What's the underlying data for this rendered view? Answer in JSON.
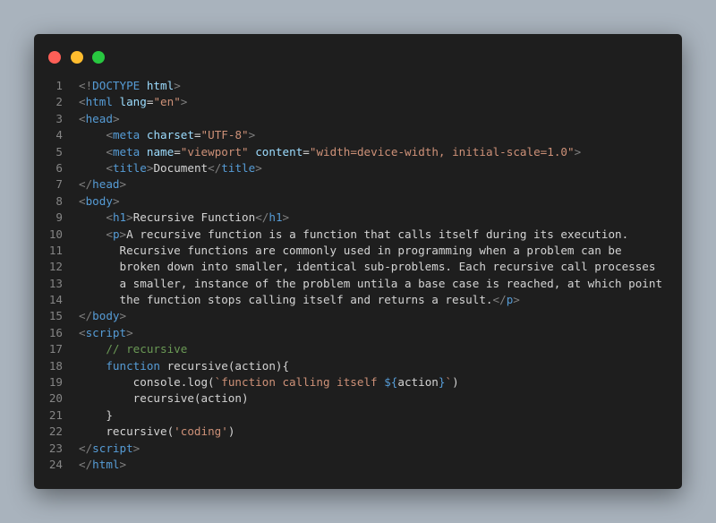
{
  "window": {
    "controls": [
      "close",
      "minimize",
      "maximize"
    ]
  },
  "colors": {
    "background": "#a9b3bd",
    "editor_bg": "#1e1e1e",
    "close": "#ff5f57",
    "minimize": "#febc2e",
    "maximize": "#28c840",
    "tag": "#569cd6",
    "punctuation": "#808080",
    "attribute": "#9cdcfe",
    "string": "#ce9178",
    "comment": "#6a9955",
    "text": "#d4d4d4",
    "line_number": "#858585"
  },
  "code_lines": [
    {
      "n": "1",
      "tokens": [
        [
          "t-punc",
          "<!"
        ],
        [
          "t-tag",
          "DOCTYPE "
        ],
        [
          "t-attr",
          "html"
        ],
        [
          "t-punc",
          ">"
        ]
      ]
    },
    {
      "n": "2",
      "tokens": [
        [
          "t-punc",
          "<"
        ],
        [
          "t-tag",
          "html "
        ],
        [
          "t-attr",
          "lang"
        ],
        [
          "t-txt",
          "="
        ],
        [
          "t-str",
          "\"en\""
        ],
        [
          "t-punc",
          ">"
        ]
      ]
    },
    {
      "n": "3",
      "tokens": [
        [
          "t-punc",
          "<"
        ],
        [
          "t-tag",
          "head"
        ],
        [
          "t-punc",
          ">"
        ]
      ]
    },
    {
      "n": "4",
      "tokens": [
        [
          "t-txt",
          "    "
        ],
        [
          "t-punc",
          "<"
        ],
        [
          "t-tag",
          "meta "
        ],
        [
          "t-attr",
          "charset"
        ],
        [
          "t-txt",
          "="
        ],
        [
          "t-str",
          "\"UTF-8\""
        ],
        [
          "t-punc",
          ">"
        ]
      ]
    },
    {
      "n": "5",
      "tokens": [
        [
          "t-txt",
          "    "
        ],
        [
          "t-punc",
          "<"
        ],
        [
          "t-tag",
          "meta "
        ],
        [
          "t-attr",
          "name"
        ],
        [
          "t-txt",
          "="
        ],
        [
          "t-str",
          "\"viewport\" "
        ],
        [
          "t-attr",
          "content"
        ],
        [
          "t-txt",
          "="
        ],
        [
          "t-str",
          "\"width=device-width, initial-scale=1.0\""
        ],
        [
          "t-punc",
          ">"
        ]
      ]
    },
    {
      "n": "6",
      "tokens": [
        [
          "t-txt",
          "    "
        ],
        [
          "t-punc",
          "<"
        ],
        [
          "t-tag",
          "title"
        ],
        [
          "t-punc",
          ">"
        ],
        [
          "t-txt",
          "Document"
        ],
        [
          "t-punc",
          "</"
        ],
        [
          "t-tag",
          "title"
        ],
        [
          "t-punc",
          ">"
        ]
      ]
    },
    {
      "n": "7",
      "tokens": [
        [
          "t-punc",
          "</"
        ],
        [
          "t-tag",
          "head"
        ],
        [
          "t-punc",
          ">"
        ]
      ]
    },
    {
      "n": "8",
      "tokens": [
        [
          "t-punc",
          "<"
        ],
        [
          "t-tag",
          "body"
        ],
        [
          "t-punc",
          ">"
        ]
      ]
    },
    {
      "n": "9",
      "tokens": [
        [
          "t-txt",
          "    "
        ],
        [
          "t-punc",
          "<"
        ],
        [
          "t-tag",
          "h1"
        ],
        [
          "t-punc",
          ">"
        ],
        [
          "t-txt",
          "Recursive Function"
        ],
        [
          "t-punc",
          "</"
        ],
        [
          "t-tag",
          "h1"
        ],
        [
          "t-punc",
          ">"
        ]
      ]
    },
    {
      "n": "10",
      "tokens": [
        [
          "t-txt",
          "    "
        ],
        [
          "t-punc",
          "<"
        ],
        [
          "t-tag",
          "p"
        ],
        [
          "t-punc",
          ">"
        ],
        [
          "t-txt",
          "A recursive function is a function that calls itself during its execution."
        ]
      ]
    },
    {
      "n": "11",
      "tokens": [
        [
          "t-txt",
          "      Recursive functions are commonly used in programming when a problem can be"
        ]
      ]
    },
    {
      "n": "12",
      "tokens": [
        [
          "t-txt",
          "      broken down into smaller, identical sub-problems. Each recursive call processes"
        ]
      ]
    },
    {
      "n": "13",
      "tokens": [
        [
          "t-txt",
          "      a smaller, instance of the problem untila a base case is reached, at which point"
        ]
      ]
    },
    {
      "n": "14",
      "tokens": [
        [
          "t-txt",
          "      the function stops calling itself and returns a result."
        ],
        [
          "t-punc",
          "</"
        ],
        [
          "t-tag",
          "p"
        ],
        [
          "t-punc",
          ">"
        ]
      ]
    },
    {
      "n": "15",
      "tokens": [
        [
          "t-punc",
          "</"
        ],
        [
          "t-tag",
          "body"
        ],
        [
          "t-punc",
          ">"
        ]
      ]
    },
    {
      "n": "16",
      "tokens": [
        [
          "t-punc",
          "<"
        ],
        [
          "t-tag",
          "script"
        ],
        [
          "t-punc",
          ">"
        ]
      ]
    },
    {
      "n": "17",
      "tokens": [
        [
          "t-txt",
          "    "
        ],
        [
          "t-com",
          "// recursive"
        ]
      ]
    },
    {
      "n": "18",
      "tokens": [
        [
          "t-txt",
          "    "
        ],
        [
          "t-kw",
          "function "
        ],
        [
          "t-txt",
          "recursive(action){"
        ]
      ]
    },
    {
      "n": "19",
      "tokens": [
        [
          "t-txt",
          "        console.log("
        ],
        [
          "t-str",
          "`function calling itself "
        ],
        [
          "t-kw",
          "${"
        ],
        [
          "t-txt",
          "action"
        ],
        [
          "t-kw",
          "}"
        ],
        [
          "t-str",
          "`"
        ],
        [
          "t-txt",
          ")"
        ]
      ]
    },
    {
      "n": "20",
      "tokens": [
        [
          "t-txt",
          "        recursive(action)"
        ]
      ]
    },
    {
      "n": "21",
      "tokens": [
        [
          "t-txt",
          "    }"
        ]
      ]
    },
    {
      "n": "22",
      "tokens": [
        [
          "t-txt",
          "    recursive("
        ],
        [
          "t-str",
          "'coding'"
        ],
        [
          "t-txt",
          ")"
        ]
      ]
    },
    {
      "n": "23",
      "tokens": [
        [
          "t-punc",
          "</"
        ],
        [
          "t-tag",
          "script"
        ],
        [
          "t-punc",
          ">"
        ]
      ]
    },
    {
      "n": "24",
      "tokens": [
        [
          "t-punc",
          "</"
        ],
        [
          "t-tag",
          "html"
        ],
        [
          "t-punc",
          ">"
        ]
      ]
    }
  ]
}
